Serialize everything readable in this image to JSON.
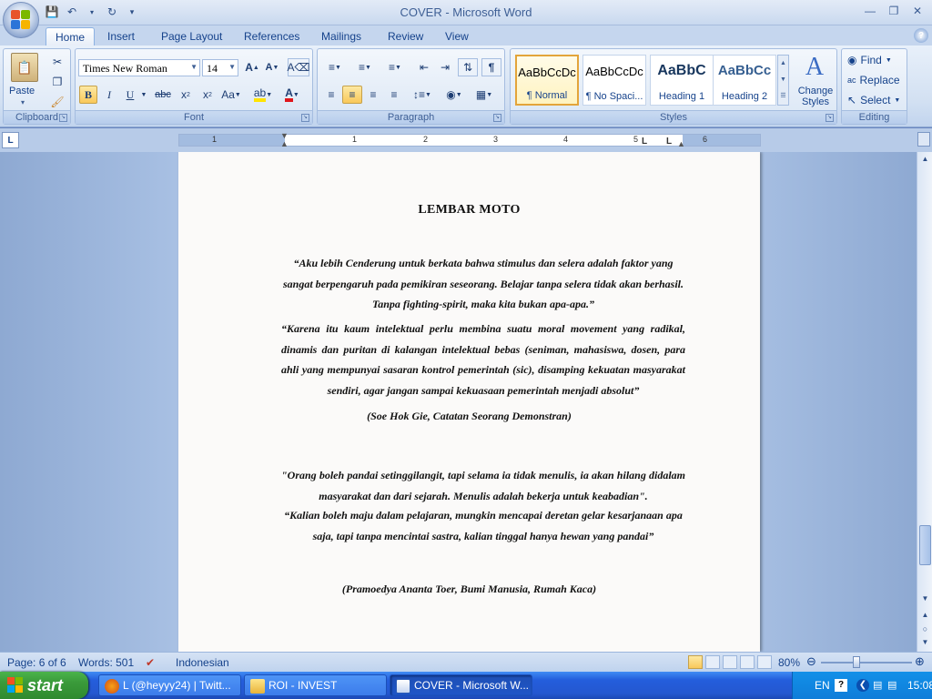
{
  "window": {
    "title": "COVER - Microsoft Word"
  },
  "tabs": [
    "Home",
    "Insert",
    "Page Layout",
    "References",
    "Mailings",
    "Review",
    "View"
  ],
  "ribbon": {
    "clipboard": {
      "label": "Clipboard",
      "paste": "Paste"
    },
    "font": {
      "label": "Font",
      "family": "Times New Roman",
      "size": "14"
    },
    "paragraph": {
      "label": "Paragraph"
    },
    "styles": {
      "label": "Styles",
      "items": [
        {
          "sample": "AaBbCcDc",
          "name": "¶ Normal"
        },
        {
          "sample": "AaBbCcDc",
          "name": "¶ No Spaci..."
        },
        {
          "sample": "AaBbC",
          "name": "Heading 1"
        },
        {
          "sample": "AaBbCc",
          "name": "Heading 2"
        }
      ],
      "change": [
        "Change",
        "Styles"
      ]
    },
    "editing": {
      "label": "Editing",
      "find": "Find",
      "replace": "Replace",
      "select": "Select"
    }
  },
  "ruler": {
    "numbers": [
      "1",
      "1",
      "2",
      "3",
      "4",
      "5",
      "6"
    ]
  },
  "document": {
    "title": "LEMBAR MOTO",
    "quote1": "“Aku lebih Cenderung untuk berkata bahwa stimulus dan selera adalah faktor yang sangat berpengaruh pada pemikiran seseorang. Belajar tanpa selera tidak akan berhasil. Tanpa fighting-spirit, maka kita bukan apa-apa.”",
    "quote2": "“Karena itu kaum intelektual perlu membina suatu moral movement yang radikal, dinamis dan puritan di kalangan intelektual bebas (seniman, mahasiswa, dosen, para ahli yang mempunyai sasaran kontrol pemerintah (sic), disamping kekuatan masyarakat sendiri, agar jangan sampai kekuasaan pemerintah menjadi absolut”",
    "credit1": "(Soe Hok Gie, Catatan Seorang Demonstran)",
    "quote3": "\"Orang boleh pandai setinggilangit, tapi selama ia tidak menulis, ia akan hilang didalam masyarakat dan dari sejarah. Menulis adalah bekerja untuk keabadian\".",
    "quote4": "“Kalian boleh maju dalam pelajaran, mungkin mencapai deretan gelar kesarjanaan apa saja, tapi tanpa mencintai sastra, kalian tinggal hanya hewan yang pandai”",
    "credit2": "(Pramoedya Ananta Toer, Bumi Manusia, Rumah Kaca)"
  },
  "status": {
    "page": "Page: 6 of 6",
    "words": "Words: 501",
    "language": "Indonesian",
    "zoom": "80%"
  },
  "taskbar": {
    "start": "start",
    "tasks": [
      "L (@heyyy24) | Twitt...",
      "ROI - INVEST",
      "COVER - Microsoft W..."
    ],
    "tray_lang": "EN",
    "clock": "15:08"
  },
  "colors": {
    "accent": "#15428b",
    "selected_style": "#e3a43a",
    "taskbar": "#245edc",
    "start": "#3a9a3a"
  }
}
